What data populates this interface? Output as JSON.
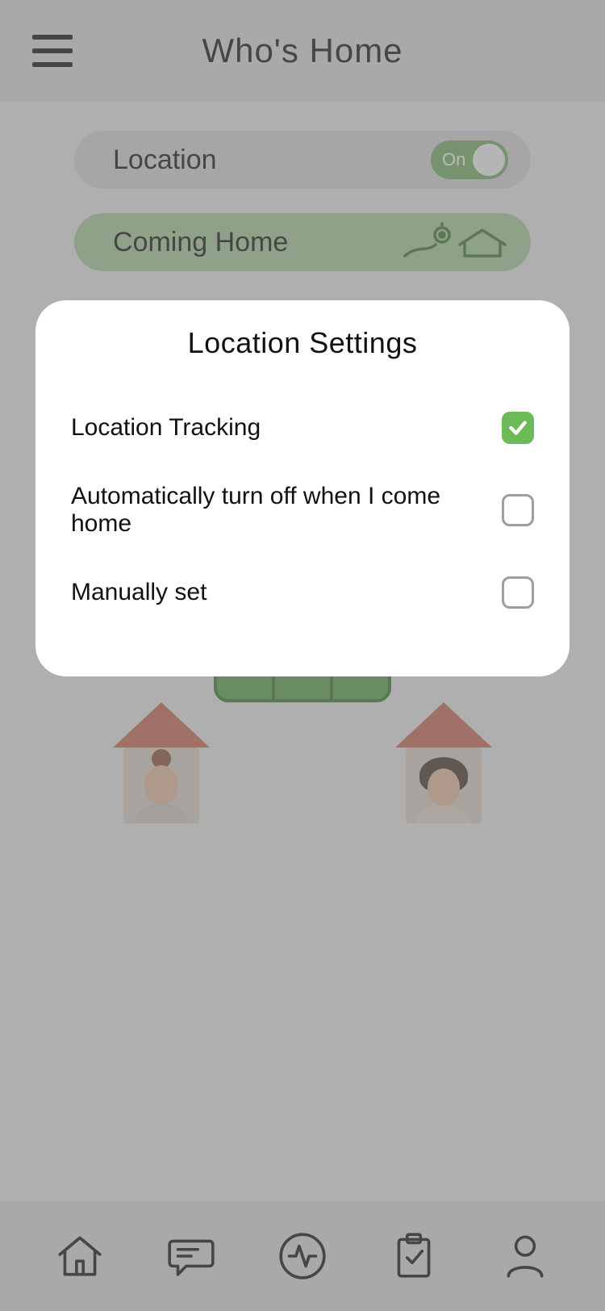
{
  "header": {
    "title": "Who's Home"
  },
  "location_pill": {
    "label": "Location",
    "toggle_text": "On",
    "toggle_on": true
  },
  "coming_home_pill": {
    "label": "Coming Home"
  },
  "modal": {
    "title": "Location Settings",
    "options": [
      {
        "label": "Location Tracking",
        "checked": true
      },
      {
        "label": "Automatically turn off when I come home",
        "checked": false
      },
      {
        "label": "Manually set",
        "checked": false
      }
    ]
  },
  "nav_icons": [
    "home-icon",
    "chat-icon",
    "activity-icon",
    "checklist-icon",
    "profile-icon"
  ]
}
